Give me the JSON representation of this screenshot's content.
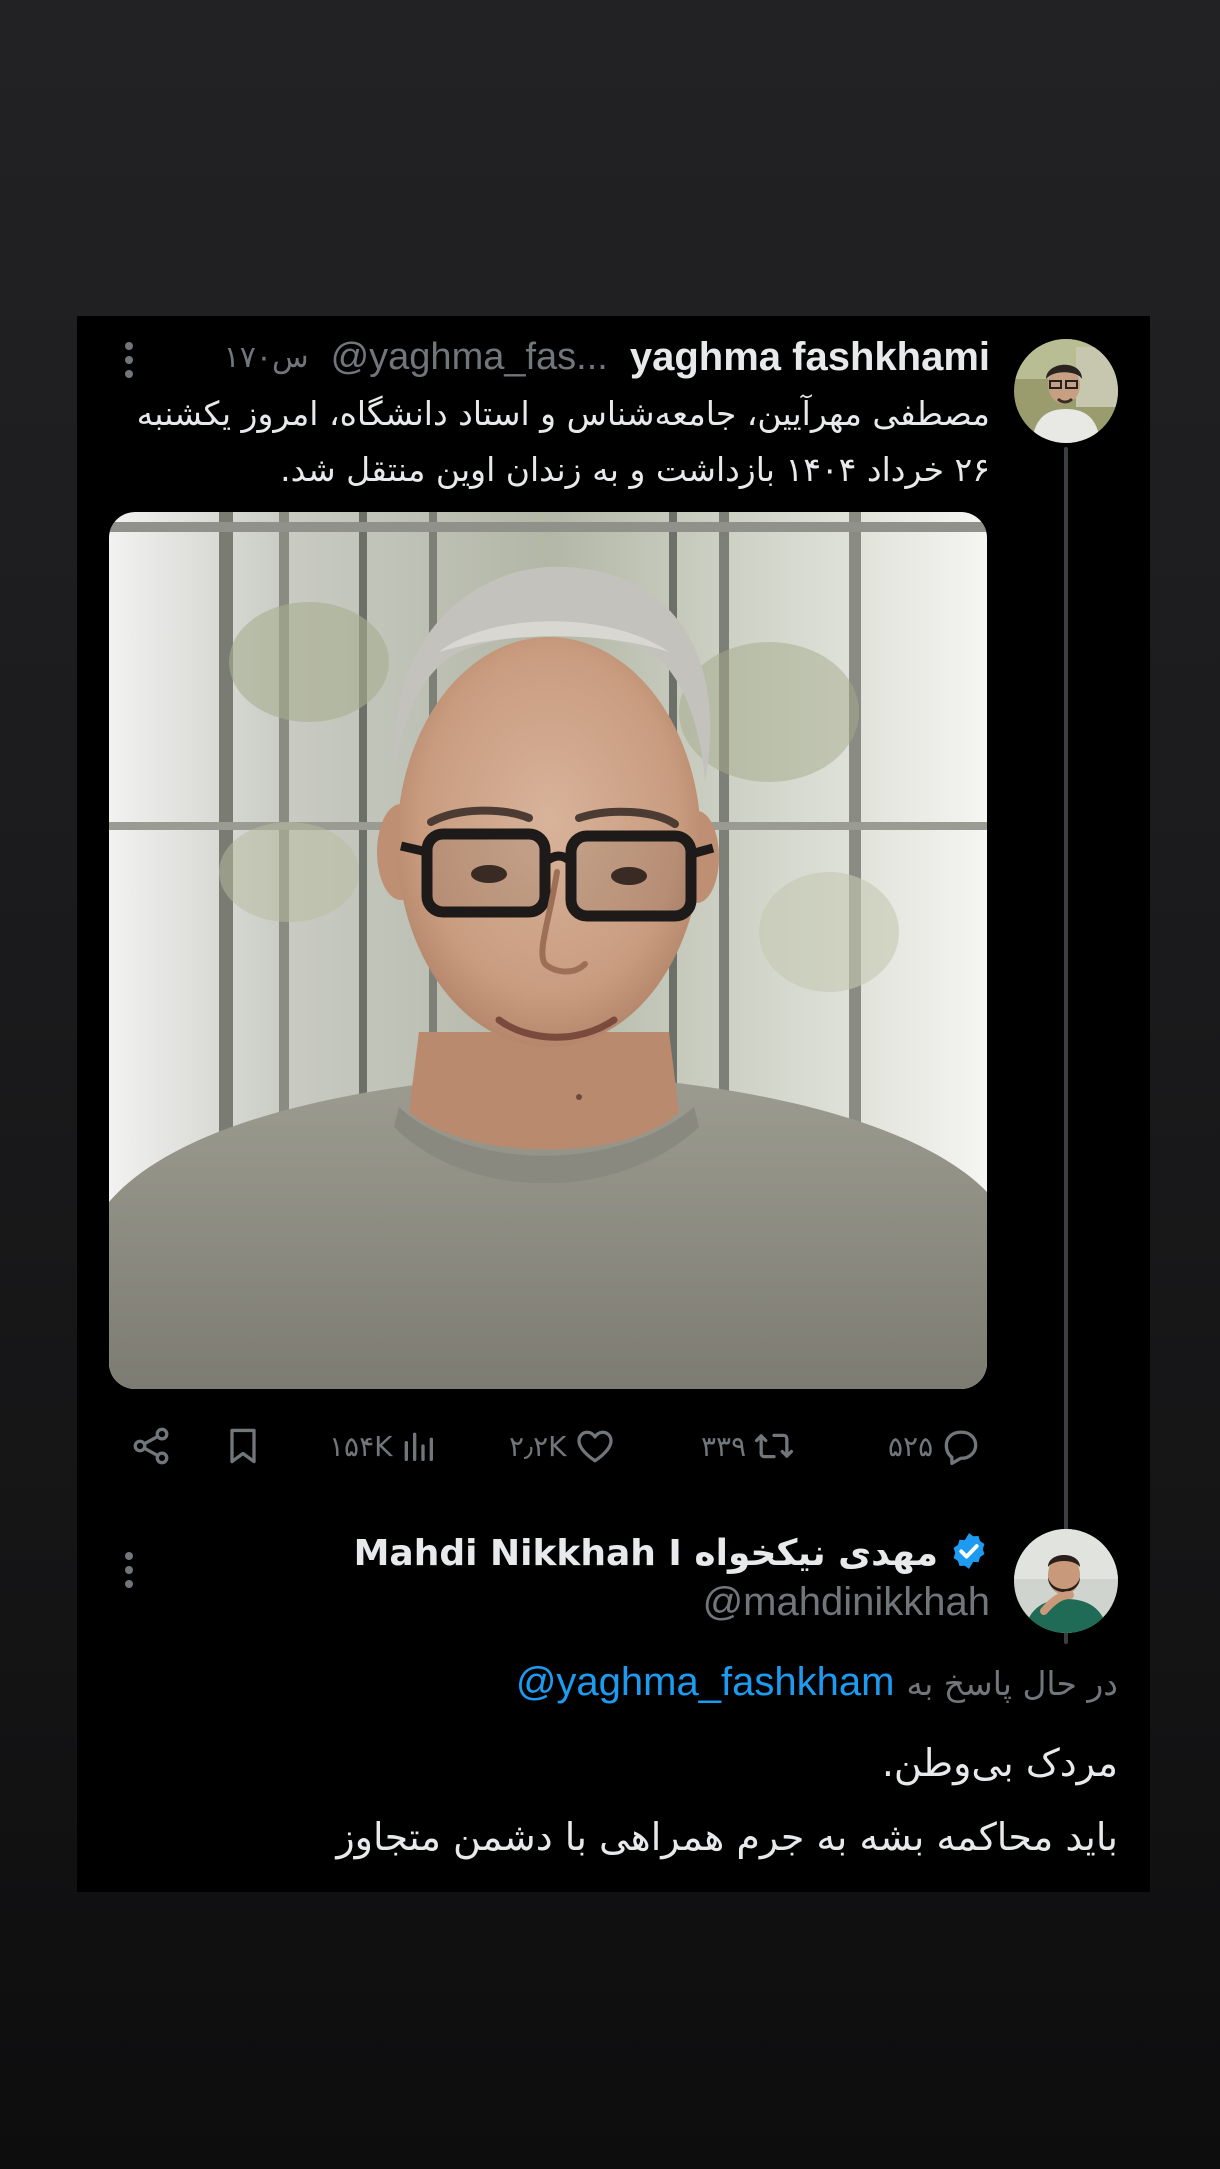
{
  "original_tweet": {
    "author_name": "yaghma fashkhami",
    "handle": "@yaghma_fas...",
    "time": "۱۷۰س",
    "text": "مصطفی مهرآیین، جامعه‌شناس و استاد دانشگاه، امروز یکشنبه ۲۶ خرداد ۱۴۰۴ بازداشت و به زندان اوین منتقل شد.",
    "actions": {
      "replies": "۵۲۵",
      "retweets": "۳۳۹",
      "likes": "۲٫۲K",
      "views": "۱۵۴K"
    }
  },
  "reply_tweet": {
    "author_name": "Mahdi Nikkhah I مهدی نیکخواه",
    "handle": "@mahdinikkhah",
    "replying_label": "در حال پاسخ به",
    "replying_handle": "@yaghma_fashkham",
    "text_lines": [
      "مردک بی‌وطن.",
      "باید محاکمه بشه به جرم همراهی با دشمن متجاوز"
    ]
  },
  "colors": {
    "background": "#000000",
    "primary_text": "#e7e9ea",
    "secondary_text": "#71767b",
    "link": "#1d9bf0",
    "verified": "#1d9bf0",
    "thread_line": "#3b3e42"
  }
}
